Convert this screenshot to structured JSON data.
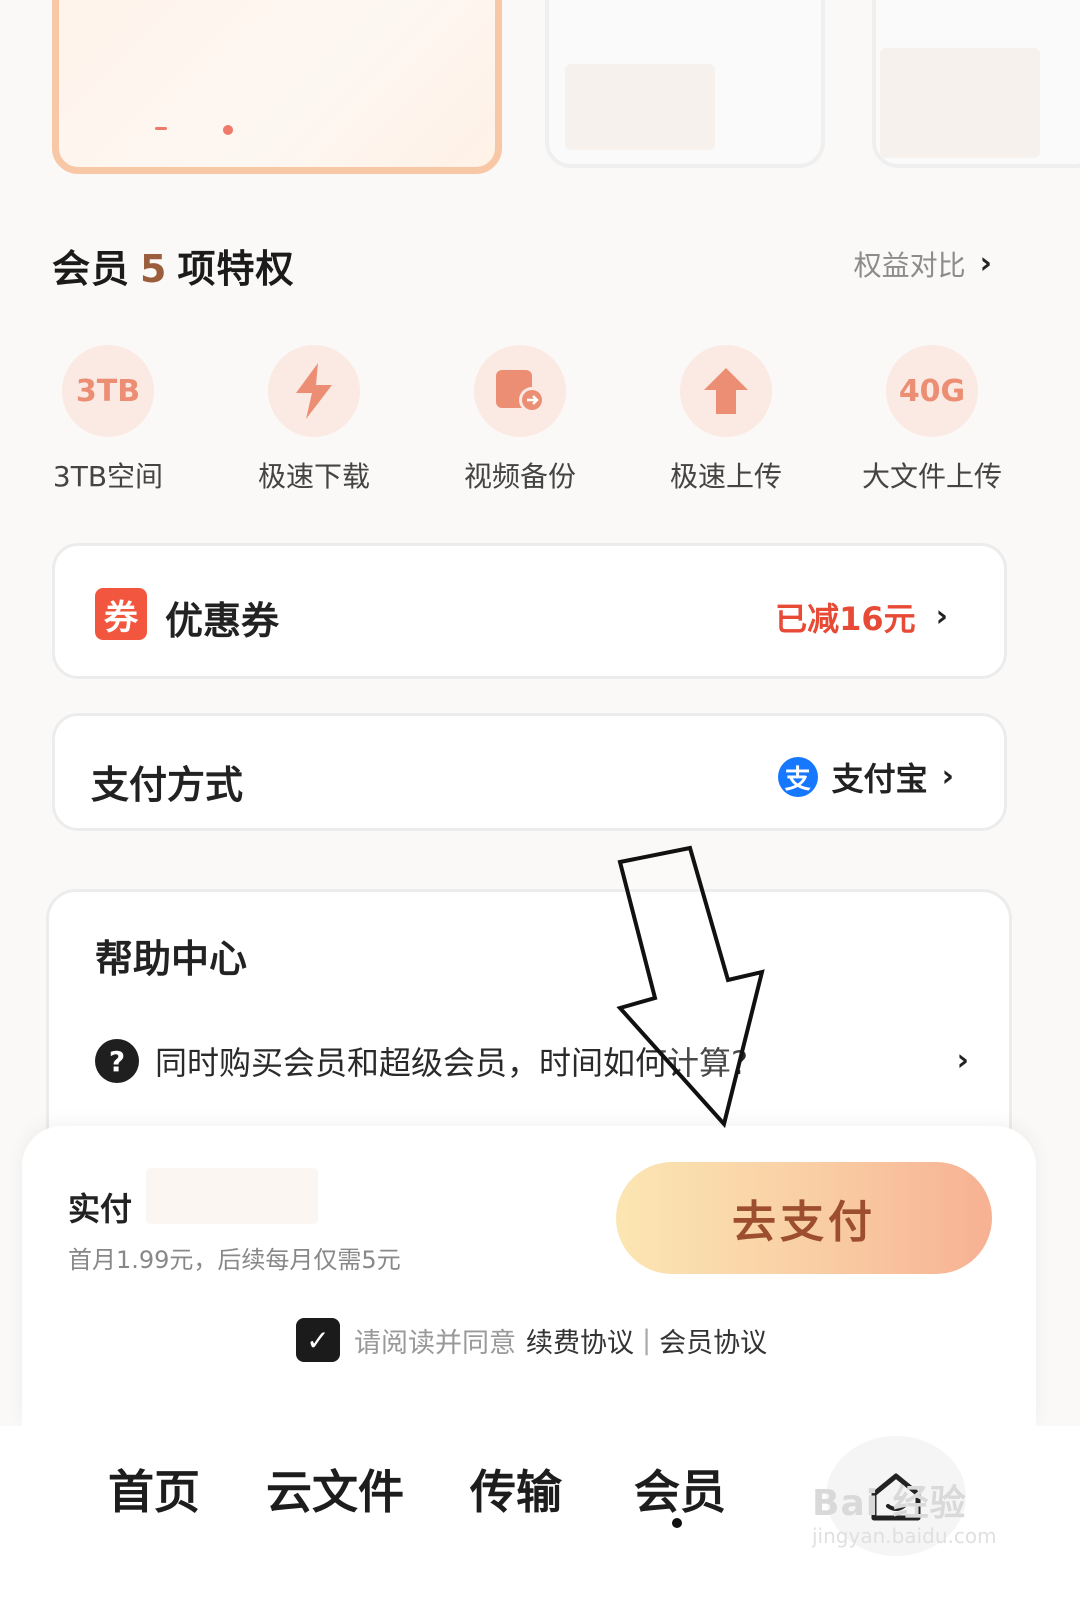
{
  "privileges": {
    "title_prefix": "会员",
    "count": "5",
    "title_suffix": "项特权",
    "compare_label": "权益对比",
    "items": [
      {
        "icon_text": "3TB",
        "icon": "storage-icon",
        "label": "3TB空间"
      },
      {
        "icon_text": "",
        "icon": "lightning-icon",
        "label": "极速下载"
      },
      {
        "icon_text": "",
        "icon": "video-backup-icon",
        "label": "视频备份"
      },
      {
        "icon_text": "",
        "icon": "upload-arrow-icon",
        "label": "极速上传"
      },
      {
        "icon_text": "40G",
        "icon": "large-file-icon",
        "label": "大文件上传"
      }
    ]
  },
  "coupon": {
    "badge": "券",
    "label": "优惠券",
    "value": "已减16元"
  },
  "payment": {
    "label": "支付方式",
    "method": "支付宝",
    "method_icon": "支"
  },
  "help": {
    "title": "帮助中心",
    "faq": "同时购买会员和超级会员，时间如何计算?"
  },
  "checkout": {
    "actual_label": "实付",
    "price_note": "首月1.99元，后续每月仅需5元",
    "pay_button": "去支付",
    "agree_text": "请阅读并同意",
    "agreement_renew": "续费协议",
    "separator": "|",
    "agreement_member": "会员协议"
  },
  "nav": {
    "items": [
      "首页",
      "云文件",
      "传输",
      "会员"
    ],
    "active": "会员"
  },
  "watermark": {
    "text": "Bai 经验",
    "sub": "jingyan.baidu.com"
  },
  "colors": {
    "accent": "#e74a35",
    "brand_brown": "#9b5e3d",
    "pay_gradient_start": "#fbe6b2",
    "pay_gradient_end": "#f7b193",
    "alipay_blue": "#1677ff"
  }
}
